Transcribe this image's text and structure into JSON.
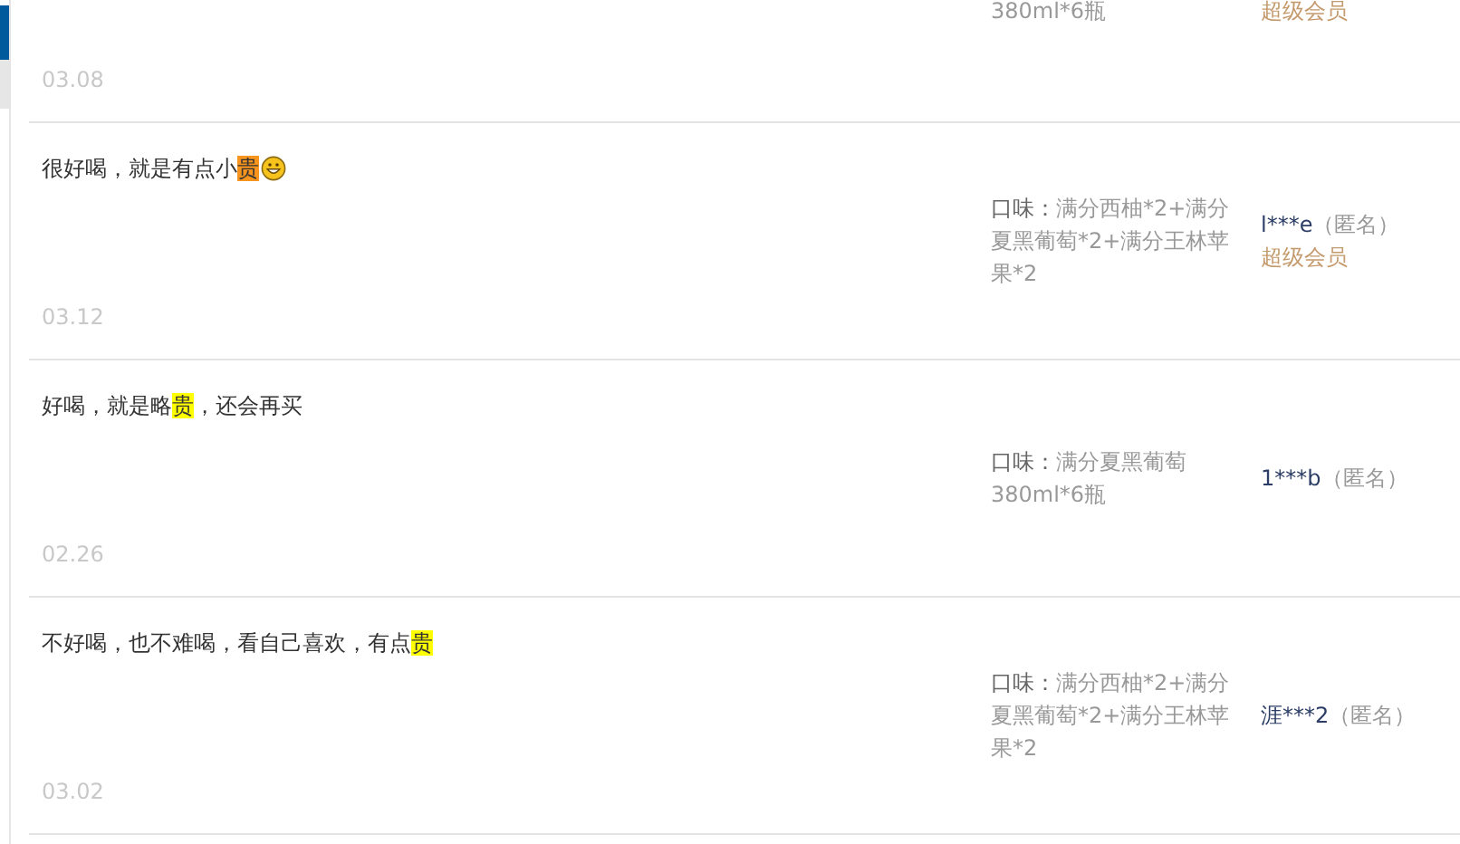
{
  "reviews": [
    {
      "emoji": false,
      "date": "03.08",
      "spec_value": "380ml*6瓶",
      "member_level": "超级会员"
    },
    {
      "comment": [
        {
          "text": "很好喝，就是有点小"
        },
        {
          "text": "贵",
          "color": "#f7941d"
        }
      ],
      "emoji": true,
      "date": "03.12",
      "spec_label": "口味：",
      "spec_value": "满分西柚*2+满分夏黑葡萄*2+满分王林苹果*2",
      "user": "l***e",
      "anonymous": "（匿名）",
      "member_level": "超级会员"
    },
    {
      "comment": [
        {
          "text": "好喝，就是略"
        },
        {
          "text": "贵",
          "color": "#ffff00"
        },
        {
          "text": "，还会再买"
        }
      ],
      "emoji": false,
      "date": "02.26",
      "spec_label": "口味：",
      "spec_value": "满分夏黑葡萄380ml*6瓶",
      "user": "1***b",
      "anonymous": "（匿名）"
    },
    {
      "comment": [
        {
          "text": "不好喝，也不难喝，看自己喜欢，有点"
        },
        {
          "text": "贵",
          "color": "#ffff00"
        }
      ],
      "emoji": false,
      "date": "03.02",
      "spec_label": "口味：",
      "spec_value": "满分西柚*2+满分夏黑葡萄*2+满分王林苹果*2",
      "user": "涯***2",
      "anonymous": "（匿名）"
    }
  ]
}
